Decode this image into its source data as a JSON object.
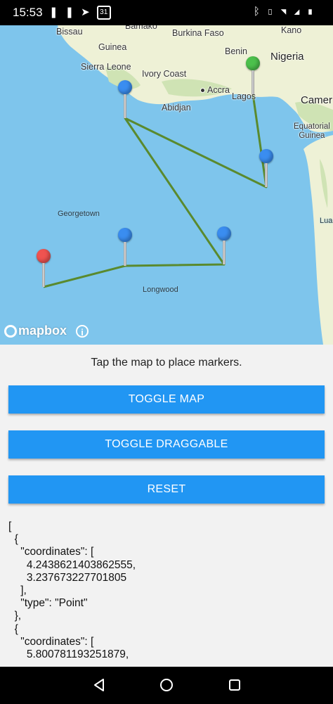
{
  "status_bar": {
    "time": "15:53",
    "left_icons": [
      "pause-icon",
      "telegram-icon",
      "calendar-icon"
    ],
    "calendar_day": "31",
    "right_icons": [
      "bluetooth-icon",
      "vibrate-icon",
      "wifi-icon",
      "signal-icon",
      "battery-icon"
    ]
  },
  "map": {
    "places": {
      "bissau": "Bissau",
      "bamako": "Bamako",
      "burkina_faso": "Burkina Faso",
      "kano": "Kano",
      "guinea": "Guinea",
      "benin": "Benin",
      "nigeria": "Nigeria",
      "sierra_leone": "Sierra Leone",
      "ivory_coast": "Ivory Coast",
      "accra": "Accra",
      "lagos": "Lagos",
      "cameroon": "Camer",
      "abidjan": "Abidjan",
      "equatorial_guinea": "Equatorial\nGuinea",
      "georgetown": "Georgetown",
      "lua": "Lua",
      "longwood": "Longwood"
    },
    "markers": [
      {
        "color": "green"
      },
      {
        "color": "blue"
      },
      {
        "color": "blue"
      },
      {
        "color": "blue"
      },
      {
        "color": "blue"
      },
      {
        "color": "red"
      }
    ],
    "route_color": "#5a8a2e",
    "attribution": "mapbox"
  },
  "panel": {
    "hint": "Tap the map to place markers.",
    "toggle_map_label": "TOGGLE MAP",
    "toggle_draggable_label": "TOGGLE DRAGGABLE",
    "reset_label": "RESET",
    "json_output": "[\n  {\n    \"coordinates\": [\n      4.2438621403862555,\n      3.237673227701805\n    ],\n    \"type\": \"Point\"\n  },\n  {\n    \"coordinates\": [\n      5.800781193251879,"
  },
  "colors": {
    "accent": "#2196f3",
    "marker_blue": "#3a8df0",
    "marker_green": "#4cc04c",
    "marker_red": "#ef5350",
    "ocean": "#7ec5ec",
    "land": "#eef1d6"
  }
}
